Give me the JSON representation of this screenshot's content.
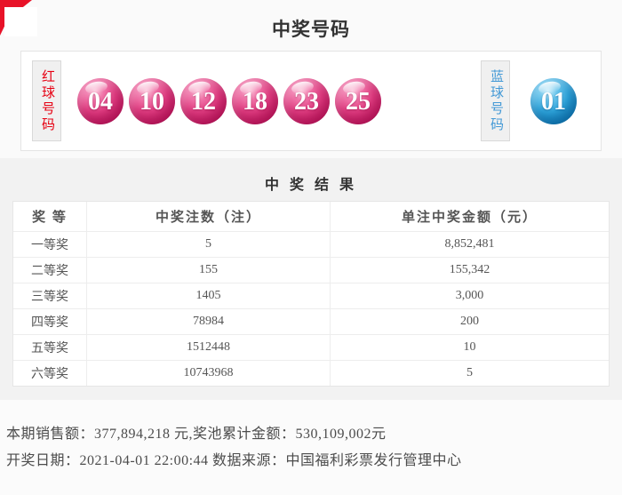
{
  "header": {
    "title": "中奖号码"
  },
  "balls": {
    "red_label": "红球号码",
    "red_numbers": [
      "04",
      "10",
      "12",
      "18",
      "23",
      "25"
    ],
    "blue_label": "蓝球号码",
    "blue_numbers": [
      "01"
    ],
    "red_ball_color": "#e23c82",
    "blue_ball_color": "#2da4db",
    "red_label_color": "#e60012",
    "blue_label_color": "#4399d6"
  },
  "results": {
    "title": "中 奖 结 果",
    "table": {
      "headers": [
        "奖 等",
        "中奖注数（注）",
        "单注中奖金额（元）"
      ],
      "rows": [
        [
          "一等奖",
          "5",
          "8,852,481"
        ],
        [
          "二等奖",
          "155",
          "155,342"
        ],
        [
          "三等奖",
          "1405",
          "3,000"
        ],
        [
          "四等奖",
          "78984",
          "200"
        ],
        [
          "五等奖",
          "1512448",
          "10"
        ],
        [
          "六等奖",
          "10743968",
          "5"
        ]
      ]
    }
  },
  "footer": {
    "sales_line": "本期销售额：377,894,218 元,奖池累计金额：530,109,002元",
    "date_line": "开奖日期：2021-04-01 22:00:44 数据来源：中国福利彩票发行管理中心"
  }
}
